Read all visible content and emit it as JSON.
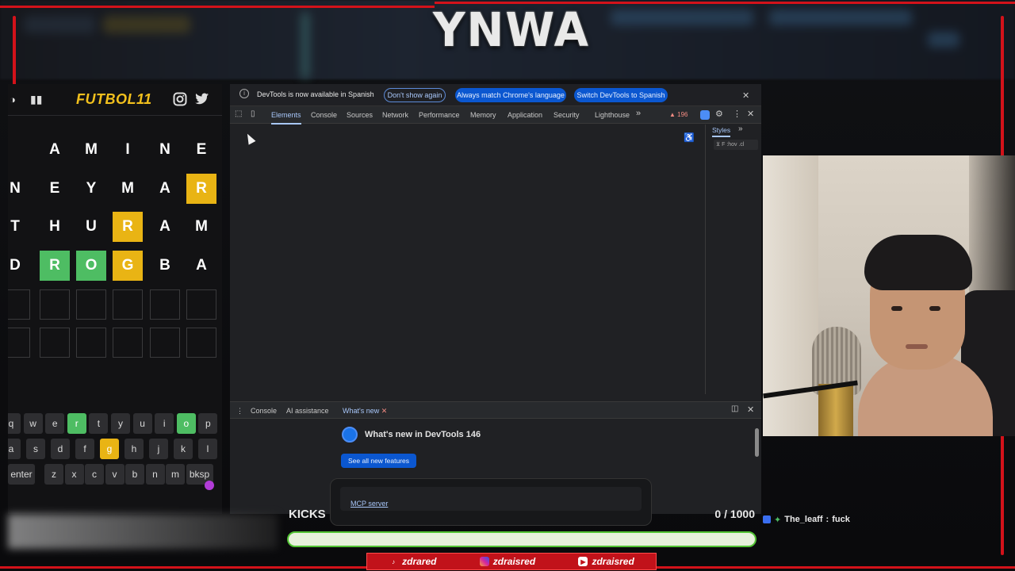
{
  "overlay": {
    "brand": "YNWA",
    "accent_color": "#d3121a"
  },
  "game": {
    "logo": "FUTBOL11",
    "icons": [
      "help-icon",
      "stats-icon",
      "instagram-icon",
      "twitter-icon"
    ],
    "rows": [
      [
        " ",
        "A",
        "M",
        "I",
        "N",
        "E"
      ],
      [
        "N",
        "E",
        "Y",
        "M",
        "A",
        "R"
      ],
      [
        "T",
        "H",
        "U",
        "R",
        "A",
        "M"
      ],
      [
        "D",
        "R",
        "O",
        "G",
        "B",
        "A"
      ],
      [
        "",
        "",
        "",
        "",
        "",
        ""
      ],
      [
        "",
        "",
        "",
        "",
        "",
        ""
      ]
    ],
    "row_states": [
      [
        "filled",
        "filled",
        "filled",
        "filled",
        "filled",
        "filled"
      ],
      [
        "filled",
        "filled",
        "filled",
        "filled",
        "filled",
        "yellow"
      ],
      [
        "filled",
        "filled",
        "filled",
        "yellow",
        "filled",
        "filled"
      ],
      [
        "filled",
        "green",
        "green",
        "yellow",
        "filled",
        "filled"
      ],
      [
        "empty",
        "empty",
        "empty",
        "empty",
        "empty",
        "empty"
      ],
      [
        "empty",
        "empty",
        "empty",
        "empty",
        "empty",
        "empty"
      ]
    ],
    "keyboard": [
      [
        "q",
        "w",
        "e",
        "r",
        "t",
        "y",
        "u",
        "i",
        "o",
        "p"
      ],
      [
        "a",
        "s",
        "d",
        "f",
        "g",
        "h",
        "j",
        "k",
        "l"
      ],
      [
        "enter",
        "z",
        "x",
        "c",
        "v",
        "b",
        "n",
        "m",
        "bksp"
      ]
    ],
    "keyboard_states": {
      "r": "green",
      "o": "green",
      "g": "yellow"
    }
  },
  "devtools": {
    "infobar": {
      "message": "DevTools is now available in Spanish",
      "dont_show": "Don't show again",
      "match_language": "Always match Chrome's language",
      "switch_language": "Switch DevTools to Spanish"
    },
    "tabs": [
      "Elements",
      "Console",
      "Sources",
      "Network",
      "Performance",
      "Memory",
      "Application",
      "Security",
      "Lighthouse"
    ],
    "more_tabs": "»",
    "warning_count": "196",
    "side_panel_tab": "Styles",
    "filter_placeholder": "F",
    "filter_show": ":hov .cl",
    "drawer_tabs": [
      "Console",
      "AI assistance",
      "What's new"
    ],
    "whats_new_title": "What's new in DevTools 146",
    "see_all": "See all new features",
    "card_link": "MCP server"
  },
  "kicks": {
    "label": "KICKS",
    "count_text": "0 / 1000",
    "progress": 0
  },
  "chat": {
    "user": "The_leaff",
    "separator": ":",
    "message": "fuck"
  },
  "socials": [
    {
      "icon": "tiktok-icon",
      "handle": "zdrared"
    },
    {
      "icon": "instagram-icon",
      "handle": "zdraisred"
    },
    {
      "icon": "youtube-icon",
      "handle": "zdraisred"
    }
  ]
}
